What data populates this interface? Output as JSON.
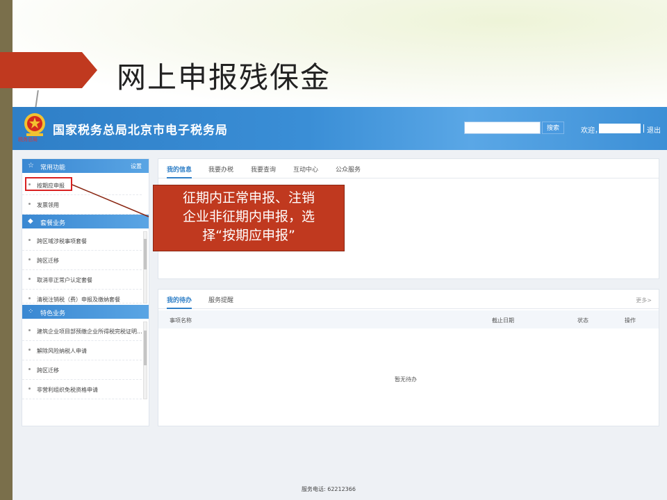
{
  "slide": {
    "title": "网上申报残保金"
  },
  "header": {
    "title": "国家税务总局北京市电子税务局",
    "emblem_text": "税务总局",
    "search_button": "搜索",
    "welcome": "欢迎，",
    "logout": "退出"
  },
  "sidebar": {
    "common": {
      "label": "常用功能",
      "settings": "设置",
      "items": [
        "按期应申报",
        "发票领用"
      ]
    },
    "packages": {
      "label": "套餐业务",
      "items": [
        "跨区域涉税事项套餐",
        "跨区迁移",
        "取消非正常户认定套餐",
        "清税注销税（费）申报及缴纳套餐"
      ]
    },
    "special": {
      "label": "特色业务",
      "items": [
        "建筑企业项目部预缴企业所得税完税证明...",
        "解除风险纳税人申请",
        "跨区迁移",
        "非营利组织免税资格申请"
      ]
    }
  },
  "info_panel": {
    "tabs": [
      "我的信息",
      "我要办税",
      "我要查询",
      "互动中心",
      "公众服务"
    ]
  },
  "todo_panel": {
    "tabs": [
      "我的待办",
      "服务提醒"
    ],
    "more": "更多>",
    "columns": [
      "事项名称",
      "截止日期",
      "状态",
      "操作"
    ],
    "empty_text": "暂无待办"
  },
  "callout": {
    "line1": "征期内正常申报、注销",
    "line2": "企业非征期内申报，选",
    "line3": "择“按期应申报”"
  },
  "footer": {
    "service_phone": "服务电话: 62212366"
  },
  "colors": {
    "header_blue": "#3a8ed6",
    "callout_red": "#c0391f",
    "highlight_red": "#d92020",
    "left_band": "#7a6f4b"
  }
}
